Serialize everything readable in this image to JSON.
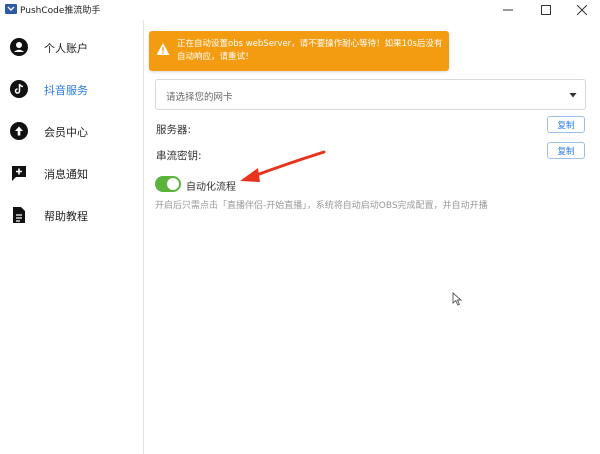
{
  "window": {
    "title": "PushCode推流助手",
    "icons": {
      "app": "app-icon",
      "minimize": "minimize-icon",
      "maximize": "maximize-icon",
      "close": "close-icon"
    }
  },
  "sidebar": {
    "items": [
      {
        "label": "个人账户",
        "icon": "account-icon",
        "active": false
      },
      {
        "label": "抖音服务",
        "icon": "tiktok-icon",
        "active": true
      },
      {
        "label": "会员中心",
        "icon": "upgrade-icon",
        "active": false
      },
      {
        "label": "消息通知",
        "icon": "message-icon",
        "active": false
      },
      {
        "label": "帮助教程",
        "icon": "document-icon",
        "active": false
      }
    ]
  },
  "toast": {
    "icon": "warning-icon",
    "text": "正在自动设置obs webServer，请不要操作耐心等待！如果10s后没有自动响应，请重试！",
    "color": "#f39c12"
  },
  "nic_select": {
    "placeholder": "请选择您的网卡"
  },
  "server": {
    "label": "服务器:",
    "copy": "复制"
  },
  "stream_key": {
    "label": "串流密钥:",
    "copy": "复制"
  },
  "automation": {
    "label": "自动化流程",
    "enabled": true,
    "hint": "开启后只需点击「直播伴侣-开始直播」，系统将自动启动OBS完成配置，并自动开播"
  },
  "colors": {
    "accent": "#2a7ae2",
    "toggle_on": "#58b43a",
    "annotation": "#e8331c"
  }
}
